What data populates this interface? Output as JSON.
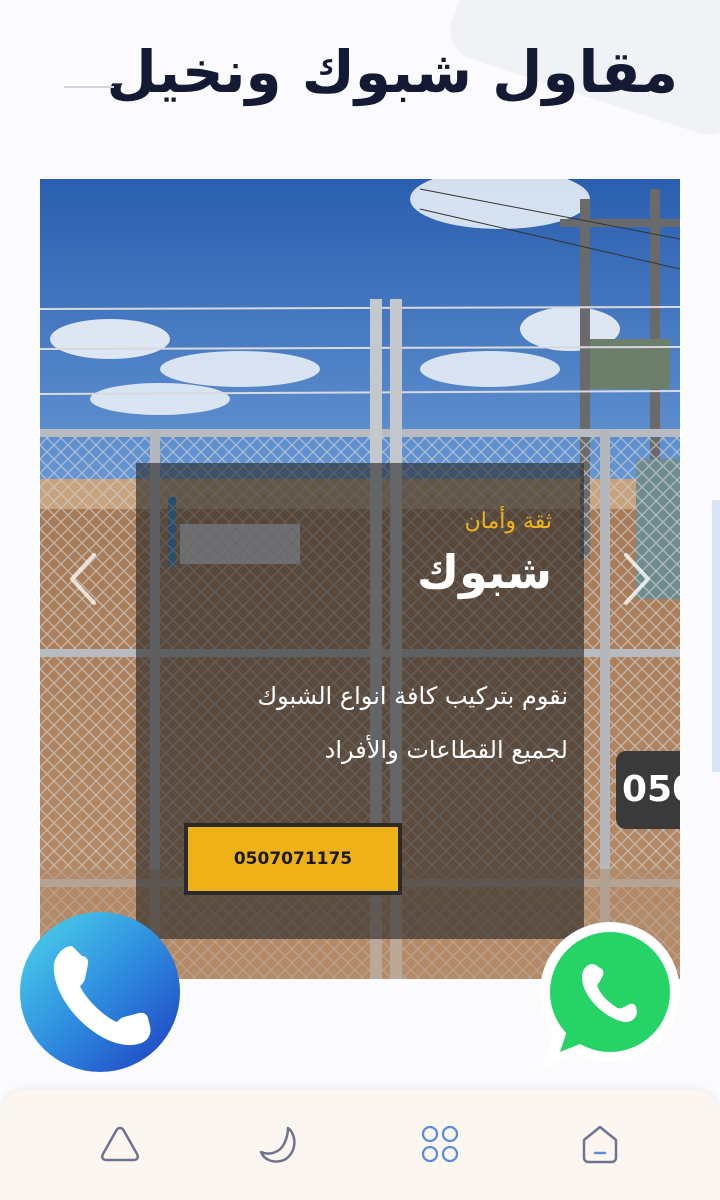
{
  "header": {
    "title": "مقاول شبوك ونخيل"
  },
  "hero": {
    "subtitle": "ثقة وأمان",
    "title": "شبوك",
    "description_line1": "نقوم بتركيب كافة انواع الشبوك",
    "description_line2": "لجميع القطاعات والأفراد",
    "button_label": "0507071175",
    "peek_phone_text": "050",
    "prev_icon": "chevron-left-icon",
    "next_icon": "chevron-right-icon"
  },
  "floating_actions": {
    "call_icon": "phone-icon",
    "whatsapp_icon": "whatsapp-icon"
  },
  "bottom_nav": {
    "items": [
      {
        "icon": "triangle-icon"
      },
      {
        "icon": "moon-icon"
      },
      {
        "icon": "grid-icon"
      },
      {
        "icon": "home-icon"
      }
    ]
  },
  "colors": {
    "title": "#141a33",
    "accent": "#eeb117",
    "subtitle": "#f0b519",
    "whatsapp": "#25d366",
    "nav_active": "#5b8fd6",
    "nav_inactive": "#6e7390"
  }
}
